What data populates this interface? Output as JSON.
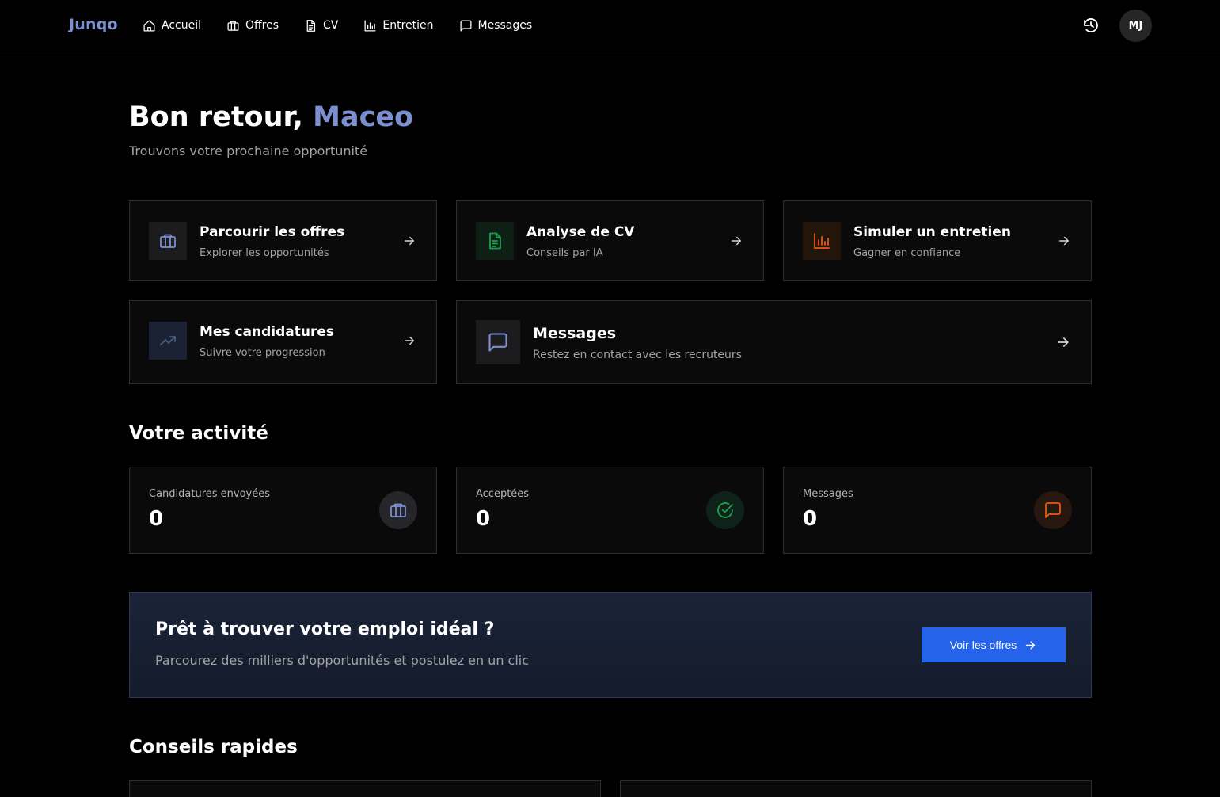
{
  "app": {
    "logo": "Junqo"
  },
  "nav": {
    "items": [
      {
        "label": "Accueil",
        "icon": "home-icon"
      },
      {
        "label": "Offres",
        "icon": "briefcase-icon"
      },
      {
        "label": "CV",
        "icon": "file-text-icon"
      },
      {
        "label": "Entretien",
        "icon": "bar-chart-icon"
      },
      {
        "label": "Messages",
        "icon": "message-square-icon"
      }
    ],
    "history_icon": "history-icon",
    "avatar_initials": "MJ"
  },
  "greeting": {
    "prefix": "Bon retour,",
    "name": "Maceo",
    "subtitle": "Trouvons votre prochaine opportunité"
  },
  "quick_actions": [
    {
      "title": "Parcourir les offres",
      "subtitle": "Explorer les opportunités",
      "icon": "briefcase-icon",
      "color": "#7b8fd1"
    },
    {
      "title": "Analyse de CV",
      "subtitle": "Conseils par IA",
      "icon": "file-text-icon",
      "color": "#16a34a"
    },
    {
      "title": "Simuler un entretien",
      "subtitle": "Gagner en confiance",
      "icon": "bar-chart-icon",
      "color": "#ea580c"
    },
    {
      "title": "Mes candidatures",
      "subtitle": "Suivre votre progression",
      "icon": "trending-up-icon",
      "color": "#4b5a80"
    },
    {
      "title": "Messages",
      "subtitle": "Restez en contact avec les recruteurs",
      "icon": "message-square-icon",
      "color": "#7b8fd1"
    }
  ],
  "activity": {
    "title": "Votre activité",
    "stats": [
      {
        "label": "Candidatures envoyées",
        "value": "0",
        "icon": "briefcase-icon",
        "color": "#7b8fd1"
      },
      {
        "label": "Acceptées",
        "value": "0",
        "icon": "check-circle-icon",
        "color": "#16a34a"
      },
      {
        "label": "Messages",
        "value": "0",
        "icon": "message-square-icon",
        "color": "#ea580c"
      }
    ]
  },
  "cta": {
    "title": "Prêt à trouver votre emploi idéal ?",
    "subtitle": "Parcourez des milliers d'opportunités et postulez en un clic",
    "button_label": "Voir les offres"
  },
  "tips": {
    "title": "Conseils rapides"
  }
}
